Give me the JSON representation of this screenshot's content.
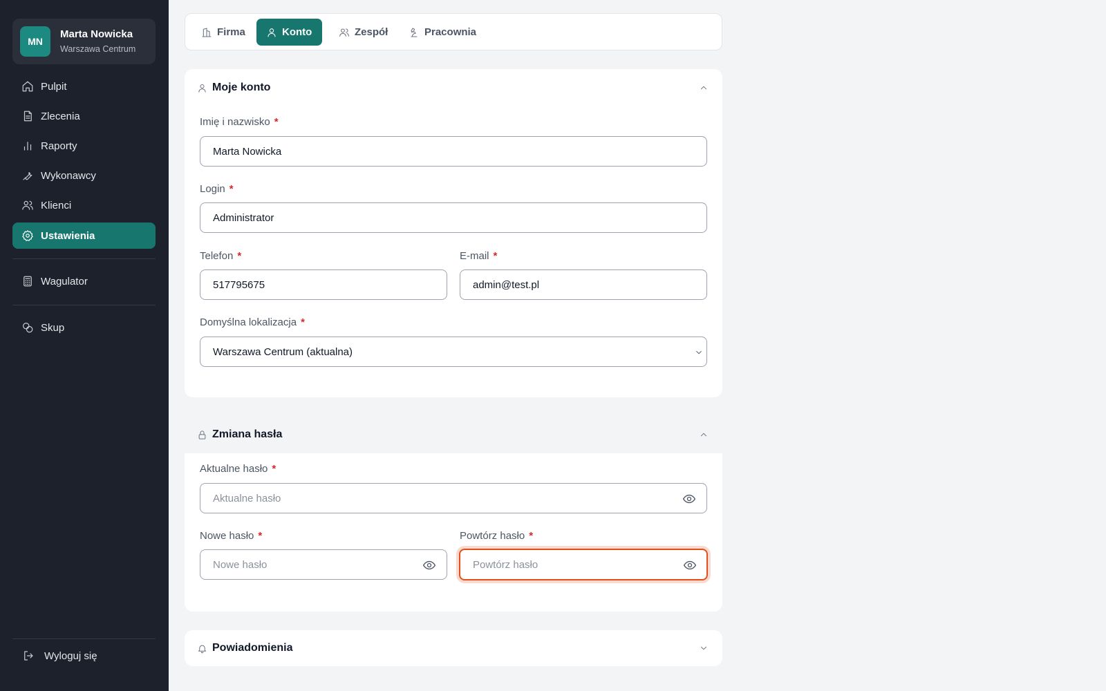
{
  "user": {
    "initials": "MN",
    "name": "Marta Nowicka",
    "location": "Warszawa Centrum"
  },
  "sidebar": {
    "items": [
      {
        "label": "Pulpit",
        "icon": "home-icon"
      },
      {
        "label": "Zlecenia",
        "icon": "document-icon"
      },
      {
        "label": "Raporty",
        "icon": "bar-chart-icon"
      },
      {
        "label": "Wykonawcy",
        "icon": "wrench-icon"
      },
      {
        "label": "Klienci",
        "icon": "users-icon"
      },
      {
        "label": "Ustawienia",
        "icon": "gear-icon",
        "active": true
      },
      {
        "label": "Wagulator",
        "icon": "calculator-icon"
      },
      {
        "label": "Skup",
        "icon": "coins-icon"
      }
    ],
    "logout_label": "Wyloguj się"
  },
  "tabs": [
    {
      "label": "Firma",
      "icon": "building-icon"
    },
    {
      "label": "Konto",
      "icon": "user-icon",
      "active": true
    },
    {
      "label": "Zespół",
      "icon": "team-icon"
    },
    {
      "label": "Pracownia",
      "icon": "microscope-icon"
    }
  ],
  "account": {
    "title": "Moje konto",
    "name_label": "Imię i nazwisko",
    "name_value": "Marta Nowicka",
    "login_label": "Login",
    "login_value": "Administrator",
    "phone_label": "Telefon",
    "phone_value": "517795675",
    "email_label": "E-mail",
    "email_value": "admin@test.pl",
    "location_label": "Domyślna lokalizacja",
    "location_value": "Warszawa Centrum (aktualna)"
  },
  "password": {
    "title": "Zmiana hasła",
    "current_label": "Aktualne hasło",
    "current_placeholder": "Aktualne hasło",
    "new_label": "Nowe hasło",
    "new_placeholder": "Nowe hasło",
    "repeat_label": "Powtórz hasło",
    "repeat_placeholder": "Powtórz hasło"
  },
  "notifications": {
    "title": "Powiadomienia"
  },
  "required_mark": "*",
  "colors": {
    "sidebar_bg": "#1d212b",
    "accent": "#17776f",
    "focus_ring": "#e24f1f",
    "required": "#dc2626"
  }
}
